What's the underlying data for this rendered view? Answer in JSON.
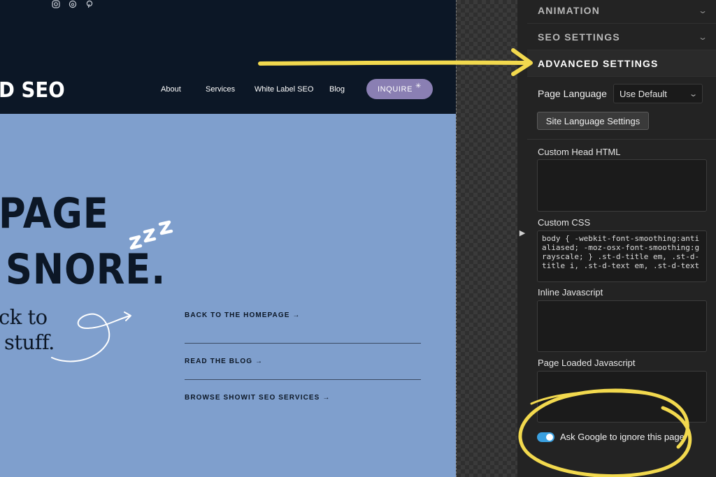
{
  "site": {
    "brand": "D SEO",
    "nav": [
      {
        "label": "About"
      },
      {
        "label": "Services"
      },
      {
        "label": "White Label SEO"
      },
      {
        "label": "Blog"
      }
    ],
    "inquire_label": "INQUIRE",
    "inquire_spark": "✳",
    "headline_1": "PAGE",
    "headline_2": "SNORE.",
    "zzz": "ZZZ",
    "script_1": "ck to",
    "script_2": "stuff.",
    "links": [
      {
        "label": "BACK TO THE HOMEPAGE →"
      },
      {
        "label": "READ THE BLOG →"
      },
      {
        "label": "BROWSE SHOWIT SEO SERVICES →"
      }
    ]
  },
  "panel": {
    "sections": {
      "animation": "ANIMATION",
      "seo": "SEO SETTINGS",
      "advanced": "ADVANCED SETTINGS"
    },
    "page_language_label": "Page Language",
    "page_language_value": "Use Default",
    "site_language_button": "Site Language Settings",
    "custom_head_label": "Custom Head HTML",
    "custom_css_label": "Custom CSS",
    "custom_css_value": "body { -webkit-font-smoothing:antialiased; -moz-osx-font-smoothing:grayscale; } .st-d-title em, .st-d-title i, .st-d-text em, .st-d-text",
    "inline_js_label": "Inline Javascript",
    "page_loaded_js_label": "Page Loaded Javascript",
    "ignore_toggle_label": "Ask Google to ignore this page",
    "ignore_toggle_on": true
  },
  "colors": {
    "annotation": "#f2d94e",
    "toggle_on": "#3aa0e0",
    "site_navy": "#0c1726",
    "site_blue": "#7f9fcd",
    "inquire": "#8a7fb3"
  }
}
